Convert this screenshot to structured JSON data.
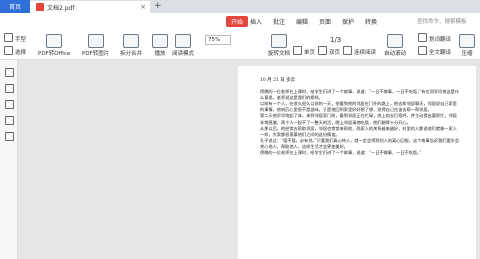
{
  "tabs": {
    "home": "首页",
    "document": "文档2.pdf",
    "close": "×",
    "add": "+"
  },
  "menu": {
    "items": [
      "开始",
      "插入",
      "批注",
      "编辑",
      "页面",
      "保护",
      "转换"
    ],
    "active": "开始",
    "search_placeholder": "查找命令、搜索模板"
  },
  "toolbar": {
    "hand": "手型",
    "select": "选择",
    "pdf_to_office": "PDF转Office",
    "pdf_to_image": "PDF转图片",
    "split_merge": "拆分合并",
    "play": "播放",
    "read_mode": "阅读模式",
    "zoom": "75%",
    "rotate_doc": "旋转文档",
    "single_page": "单页",
    "double_page": "双页",
    "continuous_read": "连续阅读",
    "auto_scroll": "自动滚动",
    "translate_text": "划词翻译",
    "full_translate": "全文翻译",
    "compress": "压缩",
    "page_indicator": "1/3"
  },
  "document": {
    "date_line": "10 月 21 日 多云",
    "paragraphs": [
      "傍晚的一位老师在上课时，给学生们讲了一个故事，说道：“一日不做事，一日不吃饭，”有位同学问他这是什么意思，老师说这是我们的榜样。",
      "以前有一个人，在很久很久以前的一天，他看到他的邻居在门外的路上，他去和邻居聊天，邻居说自己家里的事情，他听后心里很不是滋味，于是他回到家里好好想了想，觉得自己应该去帮一帮邻居。",
      "第二天他早早地起了床，来到邻居家门前，看到邻居正在忙碌，他上前去打招呼，并主动提出要帮忙，邻居非常感激，两个人一起干了一整天的活，晚上邻居请他吃饭，他们聊得十分开心。",
      "从那以后，他经常去帮助邻居，邻居也常常来帮他，两家人的关系越来越好，村里的人都说他们就像一家人一样，大家都很羡慕他们之间的这份情谊。",
      "孔子说过：“德不孤，必有邻。”只要我们真心待人，就一定会得到别人的真心回报，这个故事告诉我们要学会关心他人，帮助他人，这样生活才会更加美好。",
      "傍晚的一位老师在上课时，给学生们讲了一个故事，说道：“一日不做事，一日不吃饭。”"
    ]
  }
}
